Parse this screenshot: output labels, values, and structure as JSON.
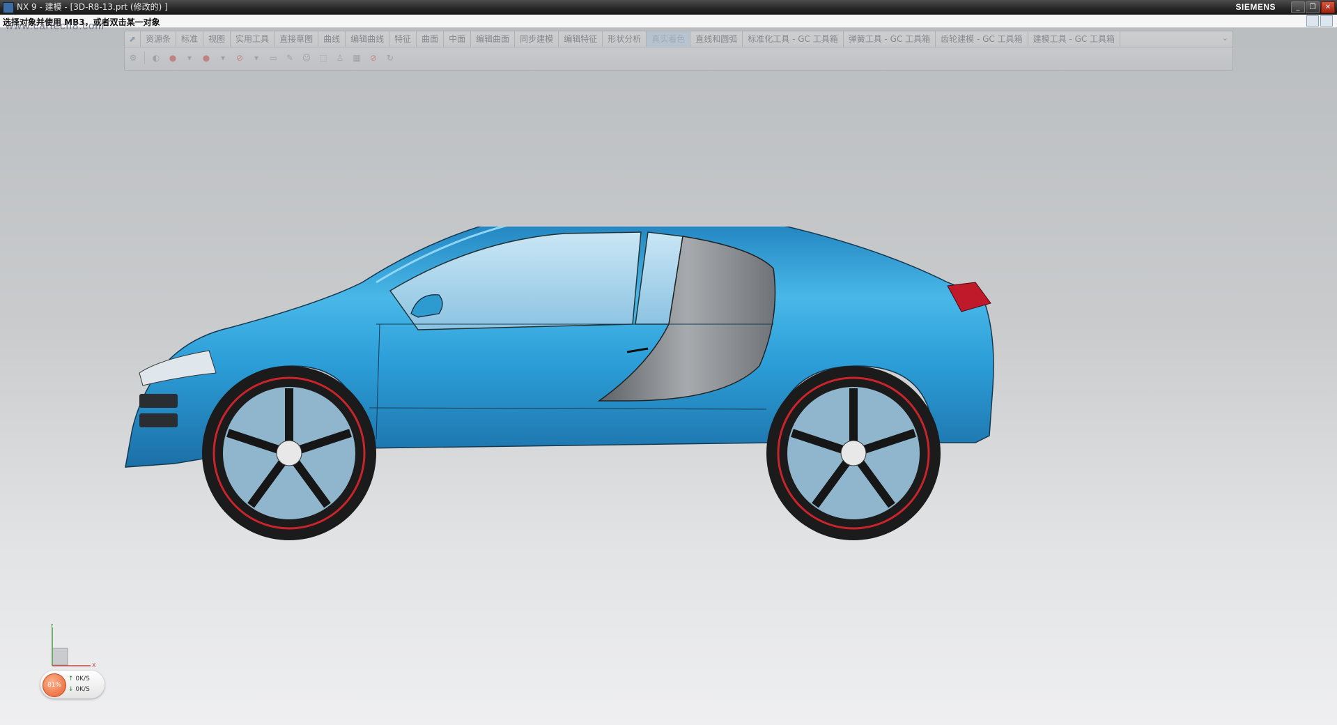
{
  "window": {
    "title": "NX 9 - 建模 - [3D-R8-13.prt (修改的) ]",
    "brand": "SIEMENS",
    "buttons": [
      "minimize",
      "restore",
      "close"
    ]
  },
  "status": {
    "prompt": "选择对象并使用 MB3，或者双击某一对象"
  },
  "watermark": "www.cartech8.com",
  "ribbon": {
    "tabs": [
      "资源条",
      "标准",
      "视图",
      "实用工具",
      "直接草图",
      "曲线",
      "编辑曲线",
      "特征",
      "曲面",
      "中面",
      "编辑曲面",
      "同步建模",
      "编辑特征",
      "形状分析",
      "真实着色",
      "直线和圆弧",
      "标准化工具 - GC 工具箱",
      "弹簧工具 - GC 工具箱",
      "齿轮建模 - GC 工具箱",
      "建模工具 - GC 工具箱"
    ],
    "active_tab": "真实着色",
    "tool_icons": [
      "gear-icon",
      "shading-icon",
      "red-sphere-icon",
      "red-sphere-2-icon",
      "no-entry-icon",
      "background-icon",
      "pen-icon",
      "person-icon",
      "box-icon",
      "figure-icon",
      "pattern-icon",
      "no-entry-2-icon",
      "refresh-icon"
    ]
  },
  "triad": {
    "x_label": "X",
    "y_label": "Y"
  },
  "net_widget": {
    "percent": "81%",
    "up": "0K/S",
    "down": "0K/S"
  },
  "colors": {
    "car_body": "#2fa3d6",
    "tail_light": "#c0192a",
    "rim_accent": "#c8242c",
    "wheel": "#1b1b1b"
  }
}
